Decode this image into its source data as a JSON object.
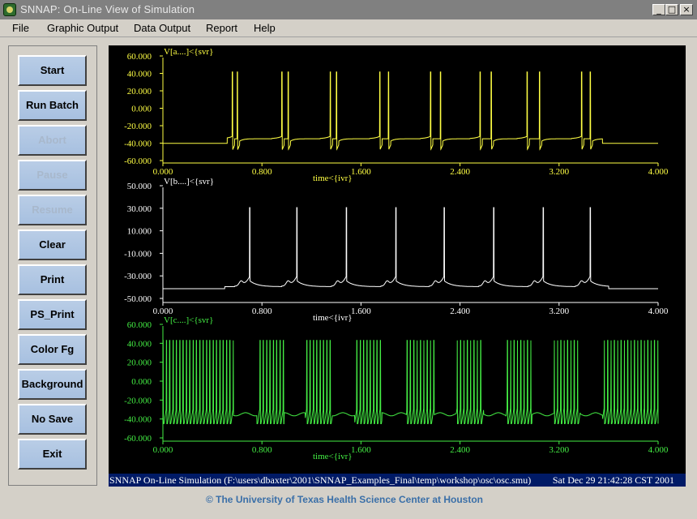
{
  "window": {
    "title": "SNNAP:  On-Line View of Simulation",
    "minimize": "_",
    "maximize": "□",
    "close": "×"
  },
  "menu": [
    "File",
    "Graphic Output",
    "Data Output",
    "Report",
    "Help"
  ],
  "buttons": [
    {
      "label": "Start",
      "enabled": true
    },
    {
      "label": "Run Batch",
      "enabled": true
    },
    {
      "label": "Abort",
      "enabled": false
    },
    {
      "label": "Pause",
      "enabled": false
    },
    {
      "label": "Resume",
      "enabled": false
    },
    {
      "label": "Clear",
      "enabled": true
    },
    {
      "label": "Print",
      "enabled": true
    },
    {
      "label": "PS_Print",
      "enabled": true
    },
    {
      "label": "Color Fg",
      "enabled": true
    },
    {
      "label": "Background",
      "enabled": true
    },
    {
      "label": "No Save",
      "enabled": true
    },
    {
      "label": "Exit",
      "enabled": true
    }
  ],
  "status": {
    "path": "SNNAP On-Line Simulation (F:\\users\\dbaxter\\2001\\SNNAP_Examples_Final\\temp\\workshop\\osc\\osc.smu)",
    "time": "Sat Dec 29 21:42:28 CST 2001"
  },
  "footer": "© The University of Texas Health Science Center at Houston",
  "chart_data": [
    {
      "type": "line",
      "title": "V[a....]<{svr}",
      "xlabel": "time<{ivr}",
      "color": "#ffff44",
      "xlim": [
        0,
        4.0
      ],
      "ylim": [
        -60,
        60
      ],
      "xticks": [
        "0.000",
        "0.800",
        "1.600",
        "2.400",
        "3.200",
        "4.000"
      ],
      "yticks": [
        "60.000",
        "40.000",
        "20.000",
        "0.000",
        "-20.000",
        "-40.000",
        "-60.000"
      ],
      "baseline": -40,
      "spike_peak": 52,
      "burst_start": 0.52,
      "burst_end": 3.55,
      "bursts": [
        {
          "t": [
            0.56,
            0.6
          ]
        },
        {
          "t": [
            0.96,
            1.01
          ]
        },
        {
          "t": [
            1.35,
            1.4
          ]
        },
        {
          "t": [
            1.75,
            1.82
          ]
        },
        {
          "t": [
            2.16,
            2.24
          ]
        },
        {
          "t": [
            2.56,
            2.65
          ]
        },
        {
          "t": [
            2.94,
            3.04
          ]
        },
        {
          "t": [
            3.38,
            3.45
          ]
        }
      ]
    },
    {
      "type": "line",
      "title": "V[b....]<{svr}",
      "xlabel": "time<{ivr}",
      "color": "#ffffff",
      "xlim": [
        0,
        4.0
      ],
      "ylim": [
        -50,
        50
      ],
      "xticks": [
        "0.000",
        "0.800",
        "1.600",
        "2.400",
        "3.200",
        "4.000"
      ],
      "yticks": [
        "50.000",
        "30.000",
        "10.000",
        "-10.000",
        "-30.000",
        "-50.000"
      ],
      "baseline": -42,
      "spike_peak": 38,
      "spikes": [
        0.7,
        1.08,
        1.48,
        1.88,
        2.27,
        2.67,
        3.07,
        3.45
      ]
    },
    {
      "type": "line",
      "title": "V[c....]<{svr}",
      "xlabel": "time<{ivr}",
      "color": "#44ee44",
      "xlim": [
        0,
        4.0
      ],
      "ylim": [
        -60,
        70
      ],
      "xticks": [
        "0.000",
        "0.800",
        "1.600",
        "2.400",
        "3.200",
        "4.000"
      ],
      "yticks": [
        "60.000",
        "40.000",
        "20.000",
        "0.000",
        "-20.000",
        "-40.000",
        "-60.000"
      ],
      "baseline": -32,
      "spike_peak": 62,
      "spike_trough": -50,
      "bursts": [
        [
          0.0,
          0.57
        ],
        [
          0.76,
          0.98
        ],
        [
          1.15,
          1.37
        ],
        [
          1.55,
          1.77
        ],
        [
          1.97,
          2.19
        ],
        [
          2.37,
          2.59
        ],
        [
          2.77,
          2.98
        ],
        [
          3.16,
          3.37
        ],
        [
          3.55,
          4.0
        ]
      ],
      "spike_interval": 0.027
    }
  ]
}
